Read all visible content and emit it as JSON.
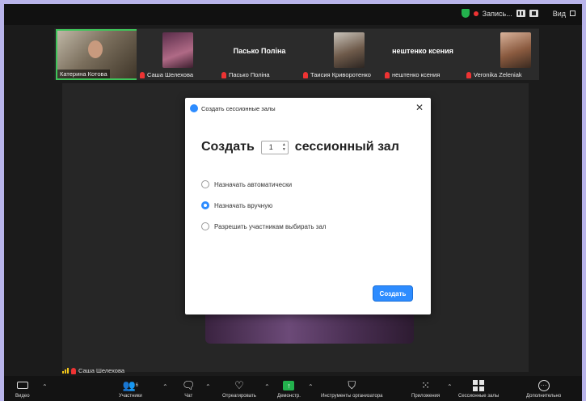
{
  "topbar": {
    "recording_label": "Запись...",
    "view_label": "Вид"
  },
  "participants": [
    {
      "name": "Катерина Котова",
      "active": true,
      "muted": false,
      "has_photo": true
    },
    {
      "name": "Саша Шелехова",
      "active": false,
      "muted": true,
      "has_photo": true
    },
    {
      "name": "Пасько Поліна",
      "big_name": "Пасько Поліна",
      "active": false,
      "muted": true,
      "has_photo": false
    },
    {
      "name": "Таисия Криворотенко",
      "active": false,
      "muted": true,
      "has_photo": true
    },
    {
      "name": "нештенко ксения",
      "big_name": "нештенко ксения",
      "active": false,
      "muted": true,
      "has_photo": false
    },
    {
      "name": "Veronika Zeleniak",
      "active": false,
      "muted": true,
      "has_photo": true
    }
  ],
  "dialog": {
    "title": "Создать сессионные залы",
    "create_prefix": "Создать",
    "room_count": "1",
    "create_suffix": "сессионный зал",
    "options": [
      {
        "label": "Назначать автоматически",
        "selected": false
      },
      {
        "label": "Назначать вручную",
        "selected": true
      },
      {
        "label": "Разрешить участникам выбирать зал",
        "selected": false
      }
    ],
    "create_button": "Создать"
  },
  "speaker": {
    "name": "Саша Шелехова"
  },
  "toolbar": {
    "participants_count": "6",
    "items": {
      "video": "Видео",
      "participants": "Участники",
      "chat": "Чат",
      "reactions": "Отреагировать",
      "share": "Демонстр.",
      "host_tools": "Инструменты организатора",
      "apps": "Приложения",
      "breakout": "Сессионные залы",
      "more": "Дополнительно"
    }
  },
  "colors": {
    "accent": "#2d8cff",
    "active_border": "#3ec45a",
    "muted": "#e33333",
    "background_frame": "#b9b4ea"
  }
}
